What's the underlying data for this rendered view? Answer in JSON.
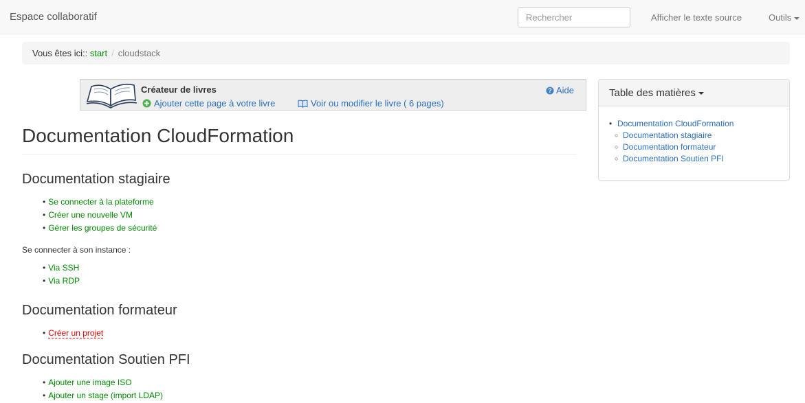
{
  "navbar": {
    "brand": "Espace collaboratif",
    "search_placeholder": "Rechercher",
    "show_source": "Afficher le texte source",
    "tools": "Outils"
  },
  "breadcrumb": {
    "prefix": "Vous êtes ici::",
    "items": [
      "start",
      "cloudstack"
    ]
  },
  "book_creator": {
    "title": "Créateur de livres",
    "add_page": "Ajouter cette page à votre livre",
    "view_book": "Voir ou modifier le livre ( 6 pages)",
    "help": "Aide"
  },
  "toc": {
    "title": "Table des matières",
    "items": [
      {
        "label": "Documentation CloudFormation",
        "level": 1
      },
      {
        "label": "Documentation stagiaire",
        "level": 2
      },
      {
        "label": "Documentation formateur",
        "level": 2
      },
      {
        "label": "Documentation Soutien PFI",
        "level": 2
      }
    ]
  },
  "content": {
    "title": "Documentation CloudFormation",
    "sections": [
      {
        "heading": "Documentation stagiaire",
        "links": [
          "Se connecter à la plateforme",
          "Créer une nouvelle VM",
          "Gérer les groupes de sécurité"
        ],
        "text": "Se connecter à son instance :",
        "sub_links": [
          "Via SSH",
          "Via RDP"
        ]
      },
      {
        "heading": "Documentation formateur",
        "links": [
          "Créer un projet"
        ]
      },
      {
        "heading": "Documentation Soutien PFI",
        "links": [
          "Ajouter une image ISO",
          "Ajouter un stage (import LDAP)"
        ]
      }
    ]
  },
  "colors": {
    "link_green": "#008800",
    "link_blue": "#2a6ebb",
    "missing_link_red": "#dd0000"
  }
}
